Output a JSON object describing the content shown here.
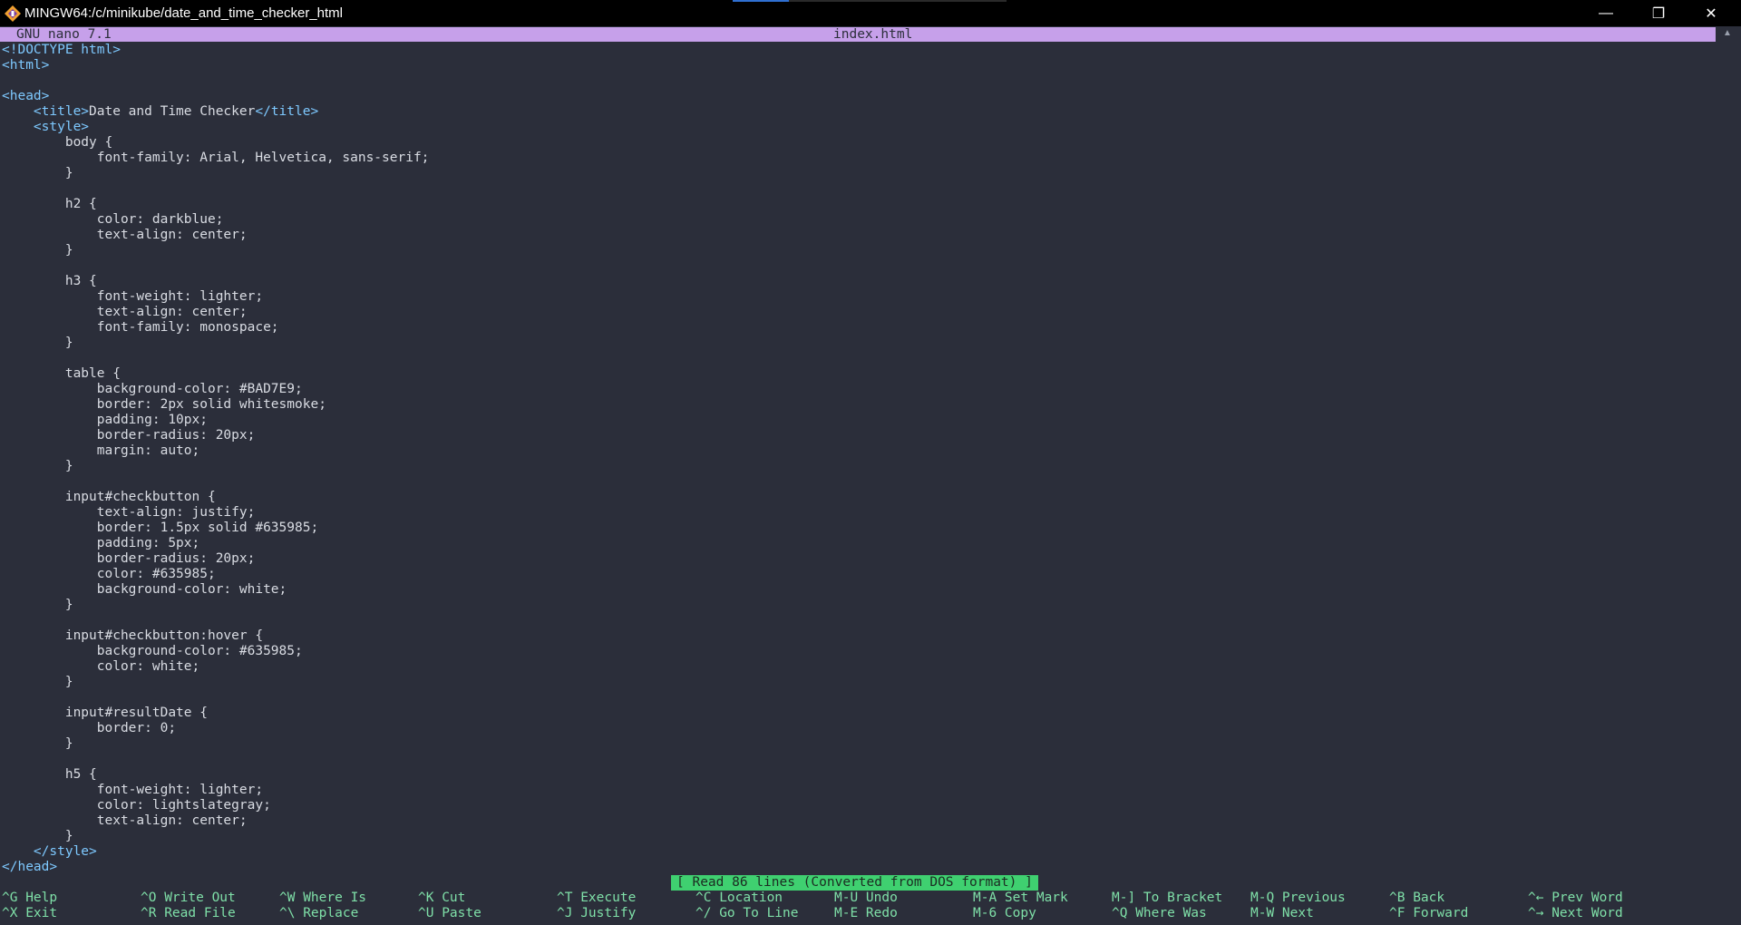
{
  "window": {
    "title": "MINGW64:/c/minikube/date_and_time_checker_html",
    "icon": "git-bash-icon",
    "controls": {
      "minimize": "—",
      "maximize": "❐",
      "close": "✕"
    }
  },
  "nano": {
    "version": "GNU nano 7.1",
    "filename": "index.html",
    "status": "[ Read 86 lines (Converted from DOS format) ]"
  },
  "code_lines": [
    [
      {
        "c": "tag",
        "t": "<!DOCTYPE html>"
      }
    ],
    [
      {
        "c": "tag",
        "t": "<html>"
      }
    ],
    [],
    [
      {
        "c": "tag",
        "t": "<head>"
      }
    ],
    [
      {
        "c": "txt",
        "t": "    "
      },
      {
        "c": "tag",
        "t": "<title>"
      },
      {
        "c": "txt",
        "t": "Date and Time Checker"
      },
      {
        "c": "tag",
        "t": "</title>"
      }
    ],
    [
      {
        "c": "txt",
        "t": "    "
      },
      {
        "c": "tag",
        "t": "<style>"
      }
    ],
    [
      {
        "c": "txt",
        "t": "        body {"
      }
    ],
    [
      {
        "c": "txt",
        "t": "            font-family: Arial, Helvetica, sans-serif;"
      }
    ],
    [
      {
        "c": "txt",
        "t": "        }"
      }
    ],
    [],
    [
      {
        "c": "txt",
        "t": "        h2 {"
      }
    ],
    [
      {
        "c": "txt",
        "t": "            color: darkblue;"
      }
    ],
    [
      {
        "c": "txt",
        "t": "            text-align: center;"
      }
    ],
    [
      {
        "c": "txt",
        "t": "        }"
      }
    ],
    [],
    [
      {
        "c": "txt",
        "t": "        h3 {"
      }
    ],
    [
      {
        "c": "txt",
        "t": "            font-weight: lighter;"
      }
    ],
    [
      {
        "c": "txt",
        "t": "            text-align: center;"
      }
    ],
    [
      {
        "c": "txt",
        "t": "            font-family: monospace;"
      }
    ],
    [
      {
        "c": "txt",
        "t": "        }"
      }
    ],
    [],
    [
      {
        "c": "txt",
        "t": "        table {"
      }
    ],
    [
      {
        "c": "txt",
        "t": "            background-color: #BAD7E9;"
      }
    ],
    [
      {
        "c": "txt",
        "t": "            border: 2px solid whitesmoke;"
      }
    ],
    [
      {
        "c": "txt",
        "t": "            padding: 10px;"
      }
    ],
    [
      {
        "c": "txt",
        "t": "            border-radius: 20px;"
      }
    ],
    [
      {
        "c": "txt",
        "t": "            margin: auto;"
      }
    ],
    [
      {
        "c": "txt",
        "t": "        }"
      }
    ],
    [],
    [
      {
        "c": "txt",
        "t": "        input#checkbutton {"
      }
    ],
    [
      {
        "c": "txt",
        "t": "            text-align: justify;"
      }
    ],
    [
      {
        "c": "txt",
        "t": "            border: 1.5px solid #635985;"
      }
    ],
    [
      {
        "c": "txt",
        "t": "            padding: 5px;"
      }
    ],
    [
      {
        "c": "txt",
        "t": "            border-radius: 20px;"
      }
    ],
    [
      {
        "c": "txt",
        "t": "            color: #635985;"
      }
    ],
    [
      {
        "c": "txt",
        "t": "            background-color: white;"
      }
    ],
    [
      {
        "c": "txt",
        "t": "        }"
      }
    ],
    [],
    [
      {
        "c": "txt",
        "t": "        input#checkbutton:hover {"
      }
    ],
    [
      {
        "c": "txt",
        "t": "            background-color: #635985;"
      }
    ],
    [
      {
        "c": "txt",
        "t": "            color: white;"
      }
    ],
    [
      {
        "c": "txt",
        "t": "        }"
      }
    ],
    [],
    [
      {
        "c": "txt",
        "t": "        input#resultDate {"
      }
    ],
    [
      {
        "c": "txt",
        "t": "            border: 0;"
      }
    ],
    [
      {
        "c": "txt",
        "t": "        }"
      }
    ],
    [],
    [
      {
        "c": "txt",
        "t": "        h5 {"
      }
    ],
    [
      {
        "c": "txt",
        "t": "            font-weight: lighter;"
      }
    ],
    [
      {
        "c": "txt",
        "t": "            color: lightslategray;"
      }
    ],
    [
      {
        "c": "txt",
        "t": "            text-align: center;"
      }
    ],
    [
      {
        "c": "txt",
        "t": "        }"
      }
    ],
    [
      {
        "c": "txt",
        "t": "    "
      },
      {
        "c": "tag",
        "t": "</style>"
      }
    ],
    [
      {
        "c": "tag",
        "t": "</head>"
      }
    ]
  ],
  "shortcuts": [
    {
      "key": "^G",
      "label": "Help"
    },
    {
      "key": "^X",
      "label": "Exit"
    },
    {
      "key": "^O",
      "label": "Write Out"
    },
    {
      "key": "^R",
      "label": "Read File"
    },
    {
      "key": "^W",
      "label": "Where Is"
    },
    {
      "key": "^\\",
      "label": "Replace"
    },
    {
      "key": "^K",
      "label": "Cut"
    },
    {
      "key": "^U",
      "label": "Paste"
    },
    {
      "key": "^T",
      "label": "Execute"
    },
    {
      "key": "^J",
      "label": "Justify"
    },
    {
      "key": "^C",
      "label": "Location"
    },
    {
      "key": "^/",
      "label": "Go To Line"
    },
    {
      "key": "M-U",
      "label": "Undo"
    },
    {
      "key": "M-E",
      "label": "Redo"
    },
    {
      "key": "M-A",
      "label": "Set Mark"
    },
    {
      "key": "M-6",
      "label": "Copy"
    },
    {
      "key": "M-]",
      "label": "To Bracket"
    },
    {
      "key": "^Q",
      "label": "Where Was"
    },
    {
      "key": "M-Q",
      "label": "Previous"
    },
    {
      "key": "M-W",
      "label": "Next"
    },
    {
      "key": "^B",
      "label": "Back"
    },
    {
      "key": "^F",
      "label": "Forward"
    },
    {
      "key": "^←",
      "label": "Prev Word"
    },
    {
      "key": "^→",
      "label": "Next Word"
    }
  ],
  "colors": {
    "background": "#2b2e3a",
    "header_bg": "#c6a0ea",
    "status_bg": "#3fd070",
    "tag": "#7ec9ff",
    "shortcut": "#7fe0a8"
  }
}
